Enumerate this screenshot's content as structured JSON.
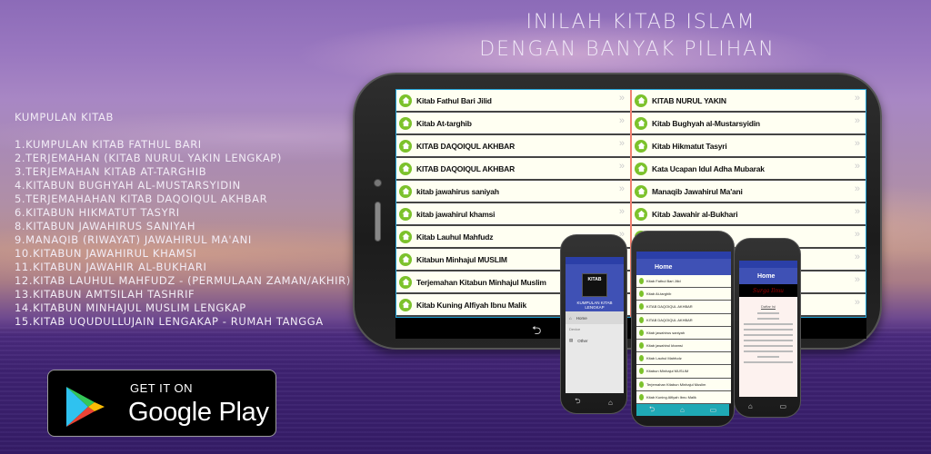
{
  "headline": {
    "line1": "INILAH KITAB ISLAM",
    "line2": "DENGAN BANYAK PILIHAN"
  },
  "kitab_list": {
    "title": "KUMPULAN KITAB",
    "items": [
      "1.KUMPULAN KITAB FATHUL BARI",
      "2.TERJEMAHAN (KITAB NURUL YAKIN LENGKAP)",
      "3.TERJEMAHAN KITAB AT-TARGHIB",
      "4.KITABUN BUGHYAH AL-MUSTARSYIDIN",
      "5.TERJEMAHAHAN KITAB DAQOIQUL AKHBAR",
      "6.KITABUN HIKMATUT TASYRI",
      "8.KITABUN JAWAHIRUS SANIYAH",
      "9.MANAQIB (RIWAYAT) JAWAHIRUL MA'ANI",
      "10.KITABUN JAWAHIRUL KHAMSI",
      "11.KITABUN JAWAHIR AL-BUKHARI",
      "12.KITAB LAUHUL MAHFUDZ - (PERMULAAN ZAMAN/AKHIR)",
      "13.KITABUN AMTSILAH TASHRIF",
      "14.KITABUN MINHAJUL MUSLIM LENGKAP",
      "15.KITAB UQUDULLUJAIN LENGAKAP - RUMAH TANGGA"
    ]
  },
  "google_play": {
    "line1": "GET IT ON",
    "line2": "Google Play"
  },
  "tablet": {
    "left_column": [
      "Kitab Fathul Bari Jilid",
      "Kitab At-targhib",
      "KITAB DAQOIQUL AKHBAR",
      "KITAB DAQOIQUL AKHBAR",
      "kitab jawahirus saniyah",
      "kitab jawahirul khamsi",
      "Kitab Lauhul Mahfudz",
      "Kitabun Minhajul MUSLIM",
      "Terjemahan Kitabun Minhajul Muslim",
      "Kitab Kuning Alfiyah Ibnu Malik"
    ],
    "right_column": [
      "KITAB NURUL YAKIN",
      "Kitab Bughyah al-Mustarsyidin",
      "Kitab Hikmatut Tasyri",
      "Kata Ucapan Idul Adha Mubarak",
      "Manaqib Jawahirul Ma'ani",
      "Kitab Jawahir al-Bukhari",
      "",
      "",
      "",
      ""
    ],
    "chevron": "»",
    "back_icon": "⮌"
  },
  "phone_drawer": {
    "logo_text": "KITAB",
    "title": "KUMPULAN KITAB LENGKAP",
    "menu_home": "Home",
    "section": "Device",
    "menu_other": "Other"
  },
  "phone_list": {
    "appbar_title": "Home",
    "items": [
      "Kitab Fathul Bari Jilid",
      "Kitab At-targhib",
      "KITAB DAQOIQUL AKHBAR",
      "KITAB DAQOIQUL AKHBAR",
      "Kitab jawahirus saniyah",
      "Kitab jawahirul khamsi",
      "Kitab Lauhul Mahfudz",
      "Kitabun Minhajul MUSLIM",
      "Terjemahan Kitabun Minhajul Muslim",
      "Kitab Kuning Alfiyah Ibnu Malik"
    ]
  },
  "phone_reader": {
    "appbar_title": "Home",
    "banner": "Surga Ilmu",
    "page_title": "Daftar Isi"
  },
  "colors": {
    "accent_green": "#7cc22b",
    "appbar_blue": "#3f51b5",
    "row_bg": "#fffff2",
    "teal_nav": "#1fa9b5"
  }
}
